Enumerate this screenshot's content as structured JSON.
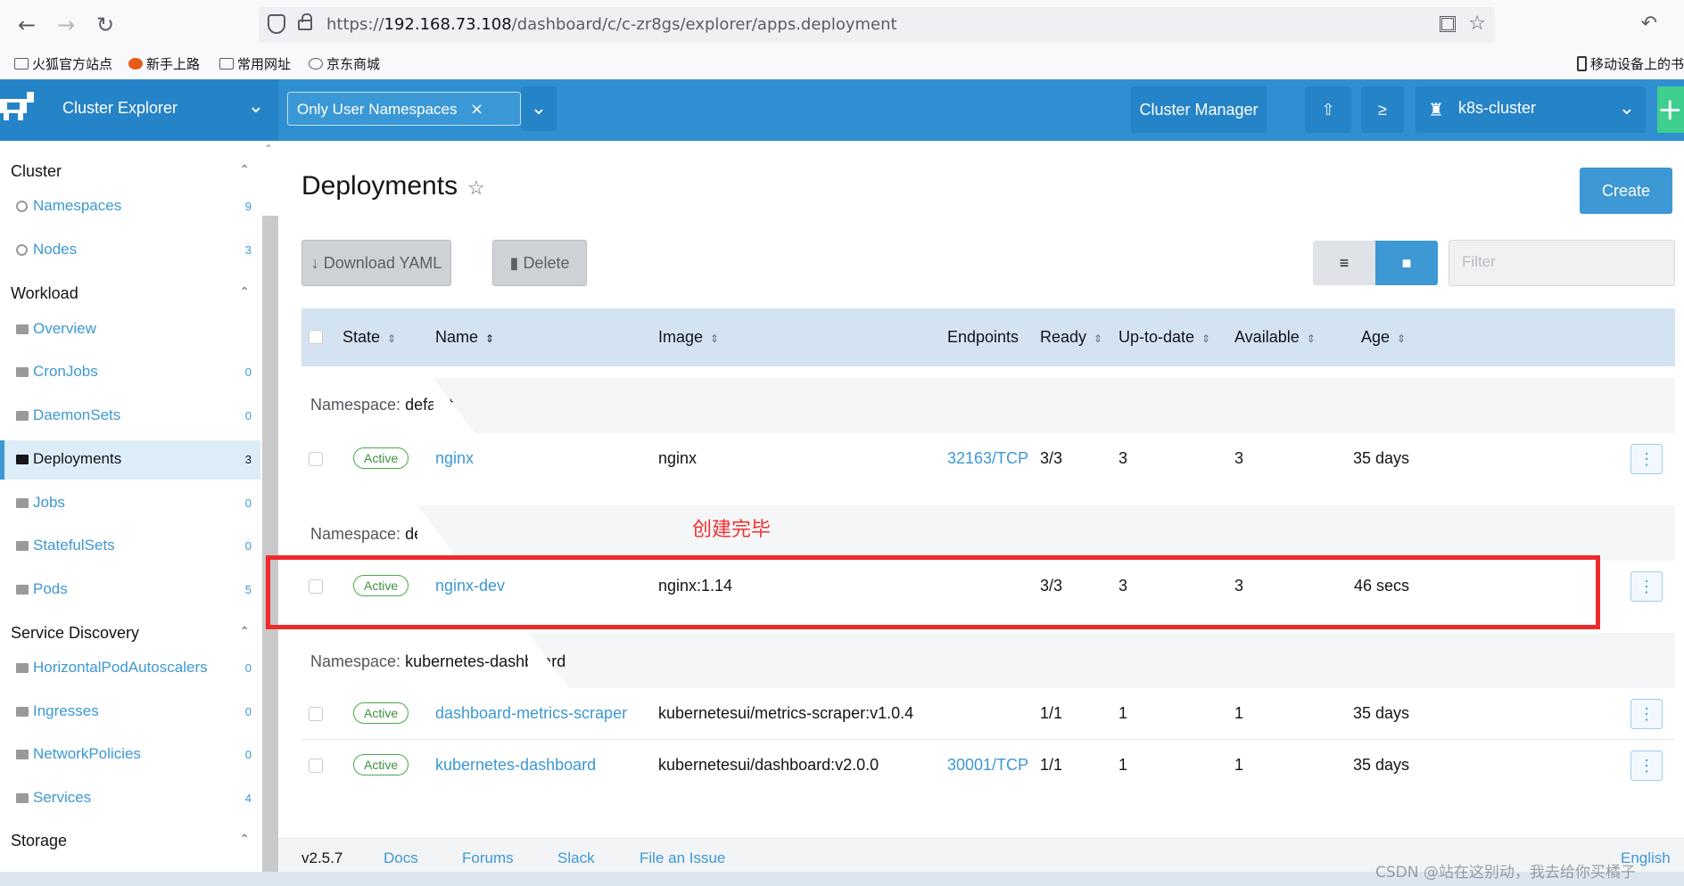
{
  "browser": {
    "url_prefix": "https://",
    "url_host": "192.168.73.108",
    "url_path": "/dashboard/c/c-zr8gs/explorer/apps.deployment",
    "bookmarks": [
      "火狐官方站点",
      "新手上路",
      "常用网址",
      "京东商城"
    ],
    "mobile_bookmarks": "移动设备上的书"
  },
  "header": {
    "product": "Cluster Explorer",
    "namespace_filter": "Only User Namespaces",
    "cluster_manager": "Cluster Manager",
    "cluster_name": "k8s-cluster"
  },
  "sidebar": {
    "groups": {
      "cluster": "Cluster",
      "workload": "Workload",
      "service_discovery": "Service Discovery",
      "storage": "Storage"
    },
    "items": [
      {
        "label": "Namespaces",
        "count": "9"
      },
      {
        "label": "Nodes",
        "count": "3"
      },
      {
        "label": "Overview",
        "count": ""
      },
      {
        "label": "CronJobs",
        "count": "0"
      },
      {
        "label": "DaemonSets",
        "count": "0"
      },
      {
        "label": "Deployments",
        "count": "3"
      },
      {
        "label": "Jobs",
        "count": "0"
      },
      {
        "label": "StatefulSets",
        "count": "0"
      },
      {
        "label": "Pods",
        "count": "5"
      },
      {
        "label": "HorizontalPodAutoscalers",
        "count": "0"
      },
      {
        "label": "Ingresses",
        "count": "0"
      },
      {
        "label": "NetworkPolicies",
        "count": "0"
      },
      {
        "label": "Services",
        "count": "4"
      }
    ]
  },
  "main": {
    "title": "Deployments",
    "create": "Create",
    "download_yaml": "Download YAML",
    "delete": "Delete",
    "filter_placeholder": "Filter",
    "columns": [
      "State",
      "Name",
      "Image",
      "Endpoints",
      "Ready",
      "Up-to-date",
      "Available",
      "Age"
    ],
    "namespace_prefix": "Namespace:",
    "groups": [
      {
        "namespace": "default",
        "rows": [
          {
            "state": "Active",
            "name": "nginx",
            "image": "nginx",
            "endpoints": "32163/TCP",
            "ready": "3/3",
            "uptodate": "3",
            "available": "3",
            "age": "35 days"
          }
        ]
      },
      {
        "namespace": "dev",
        "rows": [
          {
            "state": "Active",
            "name": "nginx-dev",
            "image": "nginx:1.14",
            "endpoints": "",
            "ready": "3/3",
            "uptodate": "3",
            "available": "3",
            "age": "46 secs"
          }
        ]
      },
      {
        "namespace": "kubernetes-dashboard",
        "rows": [
          {
            "state": "Active",
            "name": "dashboard-metrics-scraper",
            "image": "kubernetesui/metrics-scraper:v1.0.4",
            "endpoints": "",
            "ready": "1/1",
            "uptodate": "1",
            "available": "1",
            "age": "35 days"
          },
          {
            "state": "Active",
            "name": "kubernetes-dashboard",
            "image": "kubernetesui/dashboard:v2.0.0",
            "endpoints": "30001/TCP",
            "ready": "1/1",
            "uptodate": "1",
            "available": "1",
            "age": "35 days"
          }
        ]
      }
    ]
  },
  "annotation": "创建完毕",
  "footer": {
    "version": "v2.5.7",
    "links": [
      "Docs",
      "Forums",
      "Slack",
      "File an Issue"
    ],
    "language": "English"
  },
  "watermark": "CSDN @站在这别动，我去给你买橘子",
  "colors": {
    "brand_blue": "#2f8fd0",
    "link_blue": "#3d98d3",
    "active_green": "#4ba74b",
    "annotation_red": "#ee2a2a"
  }
}
